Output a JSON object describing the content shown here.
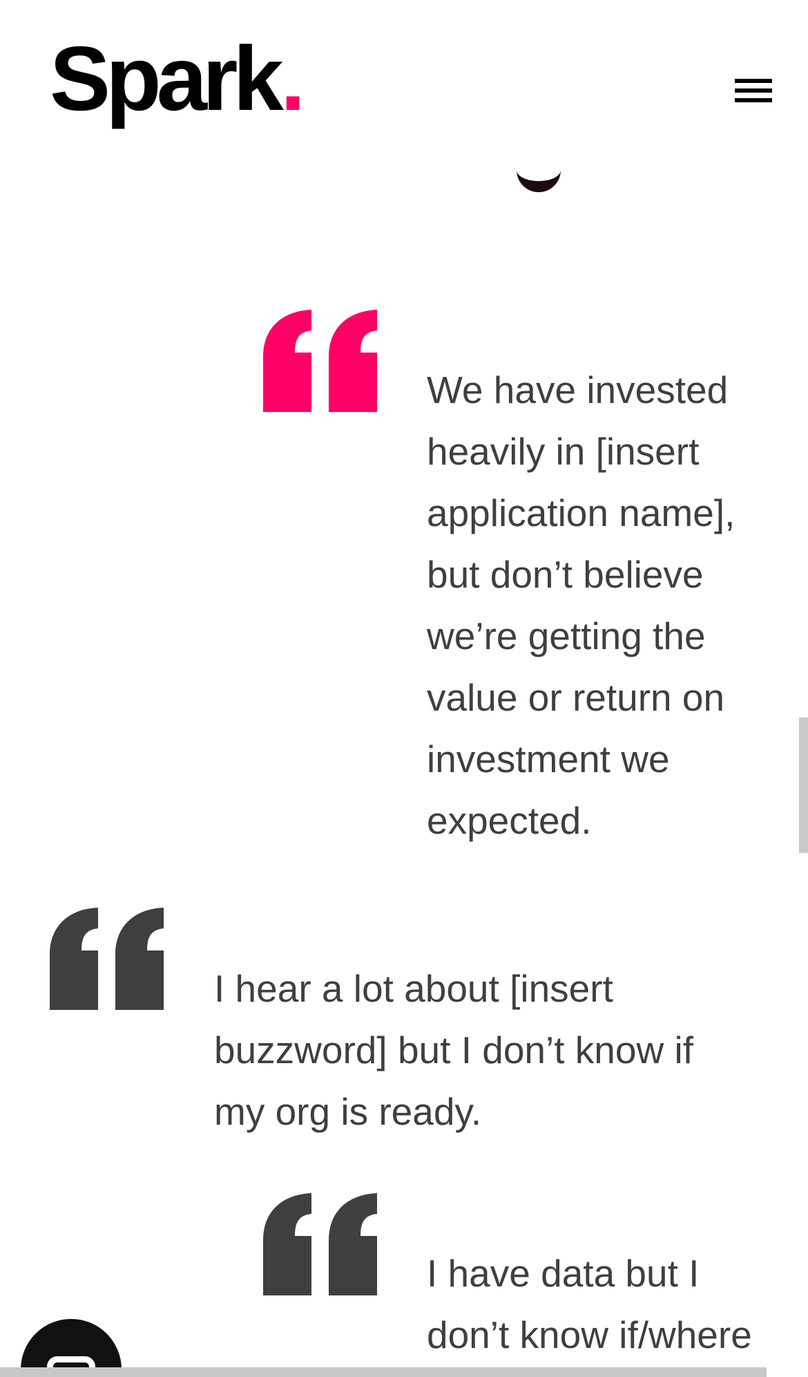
{
  "header": {
    "logo_text": "Spark",
    "logo_dot": ".",
    "menu_icon": "hamburger-menu-icon"
  },
  "colors": {
    "accent": "#ff0066",
    "text": "#3f3f3f",
    "quote_mark_dark": "#3f3f3f",
    "logo": "#000000"
  },
  "quotes": [
    {
      "text": "We have invested heavily in [insert application name], but don’t believe we’re getting the value or return on investment we expected.",
      "mark_color": "#ff0066"
    },
    {
      "text": "I hear a lot about [insert buzzword] but I don’t know if my org is ready.",
      "mark_color": "#3f3f3f"
    },
    {
      "text": "I have data but I don’t know if/where",
      "mark_color": "#3f3f3f"
    }
  ],
  "chat": {
    "icon": "chat-bubble-icon"
  }
}
